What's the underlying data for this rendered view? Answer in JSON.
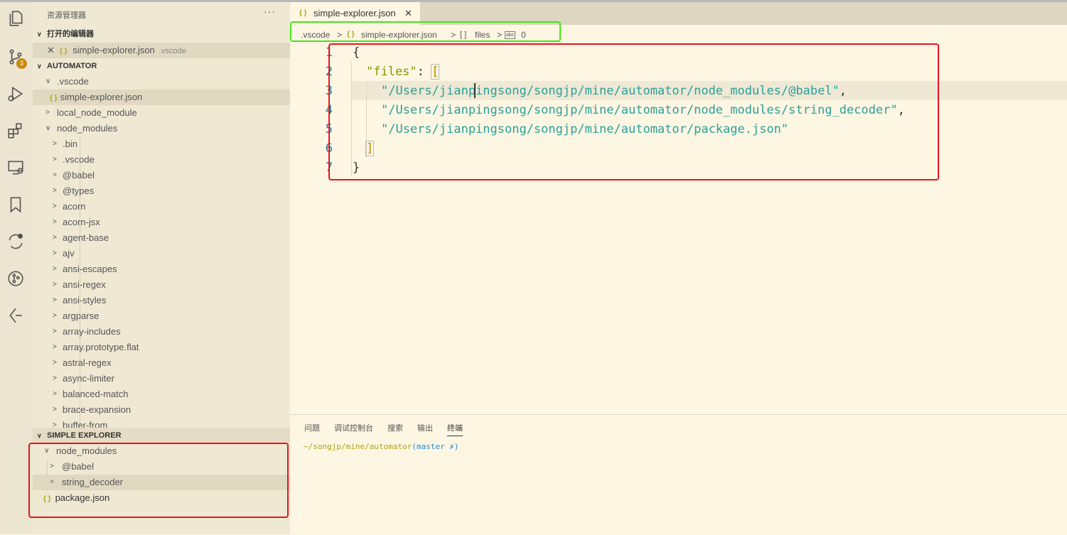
{
  "activity_bar": {
    "icons": [
      "explorer-icon",
      "source-control-icon",
      "run-debug-icon",
      "extensions-icon",
      "remote-explorer-icon",
      "bookmark-icon",
      "sync-icon",
      "git-graph-icon",
      "timeline-icon"
    ],
    "scm_badge": "3"
  },
  "sidebar": {
    "title": "资源管理器",
    "more": "···",
    "open_editors": {
      "header": "打开的编辑器",
      "items": [
        {
          "name": "simple-explorer.json",
          "folder": ".vscode"
        }
      ]
    },
    "workspace": {
      "header": "AUTOMATOR",
      "tree": [
        ".vscode",
        "simple-explorer.json",
        "local_node_module",
        "node_modules",
        ".bin",
        ".vscode",
        "@babel",
        "@types",
        "acorn",
        "acorn-jsx",
        "agent-base",
        "ajv",
        "ansi-escapes",
        "ansi-regex",
        "ansi-styles",
        "argparse",
        "array-includes",
        "array.prototype.flat",
        "astral-regex",
        "async-limiter",
        "balanced-match",
        "brace-expansion",
        "buffer-from"
      ]
    },
    "simple_explorer": {
      "header": "SIMPLE EXPLORER",
      "items": [
        "node_modules",
        "@babel",
        "string_decoder",
        "package.json"
      ]
    }
  },
  "editor": {
    "tab": {
      "name": "simple-explorer.json",
      "close": "✕"
    },
    "breadcrumb": {
      "folder": ".vscode",
      "file": "simple-explorer.json",
      "array_icon": "[ ]",
      "array": "files",
      "index_icon": "abc",
      "index": "0"
    },
    "line_numbers": [
      "1",
      "2",
      "3",
      "4",
      "5",
      "6",
      "7"
    ],
    "code": {
      "l1": "{",
      "l2_key": "\"files\"",
      "l2_colon": ": ",
      "l2_bracket": "[",
      "l3": "\"/Users/jianpingsong/songjp/mine/automator/node_modules/@babel\"",
      "l4": "\"/Users/jianpingsong/songjp/mine/automator/node_modules/string_decoder\"",
      "l5": "\"/Users/jianpingsong/songjp/mine/automator/package.json\"",
      "comma": ",",
      "l6": "]",
      "l7": "}"
    }
  },
  "panel": {
    "tabs": [
      "问题",
      "调试控制台",
      "搜索",
      "输出",
      "终端"
    ],
    "terminal_path": "~/songjp/mine/automator",
    "terminal_git": "(master ✗)"
  },
  "colors": {
    "background": "#fdf6e3",
    "sidebar": "#efe8d3",
    "activity_bar": "#ece5d1",
    "badge": "#c9890e",
    "highlight_green": "#46e516",
    "highlight_red": "#e8141e"
  }
}
